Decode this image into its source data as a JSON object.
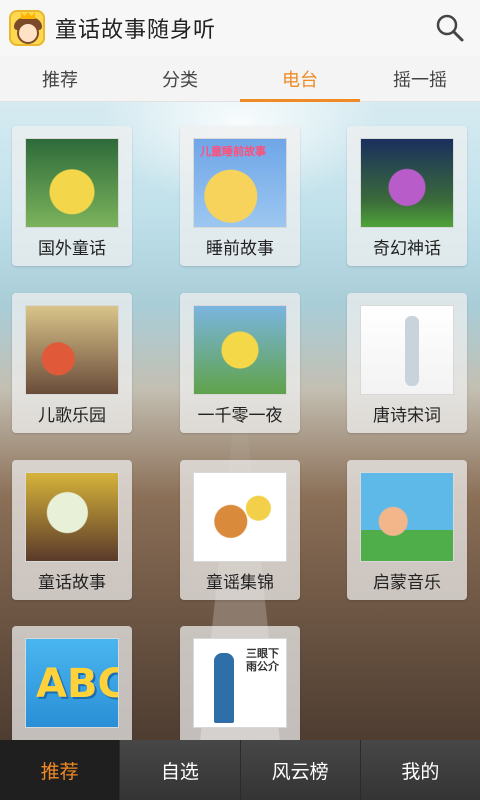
{
  "app": {
    "title": "童话故事随身听"
  },
  "tabs": [
    {
      "label": "推荐",
      "active": false
    },
    {
      "label": "分类",
      "active": false
    },
    {
      "label": "电台",
      "active": true
    },
    {
      "label": "摇一摇",
      "active": false
    }
  ],
  "stations": [
    {
      "label": "国外童话",
      "art": "fairy-in-flower"
    },
    {
      "label": "睡前故事",
      "art": "child-on-moon",
      "art_text": "儿童睡前故事"
    },
    {
      "label": "奇幻神话",
      "art": "fantasy-house"
    },
    {
      "label": "儿歌乐园",
      "art": "cartoon-kids"
    },
    {
      "label": "一千零一夜",
      "art": "princess-and-dwarfs"
    },
    {
      "label": "唐诗宋词",
      "art": "ancient-poet"
    },
    {
      "label": "童话故事",
      "art": "old-storyteller"
    },
    {
      "label": "童谣集锦",
      "art": "guitar-singers"
    },
    {
      "label": "启蒙音乐",
      "art": "child-with-headphones"
    },
    {
      "label": "",
      "art": "abc-letters",
      "art_text": "ABC"
    },
    {
      "label": "",
      "art": "xiangsheng-performer",
      "art_text": "三眼下雨公介"
    }
  ],
  "bottom_nav": [
    {
      "label": "推荐",
      "active": true
    },
    {
      "label": "自选",
      "active": false
    },
    {
      "label": "风云榜",
      "active": false
    },
    {
      "label": "我的",
      "active": false
    }
  ],
  "colors": {
    "accent": "#f08a24",
    "bottom_nav_bg": "#3a3a3a"
  }
}
